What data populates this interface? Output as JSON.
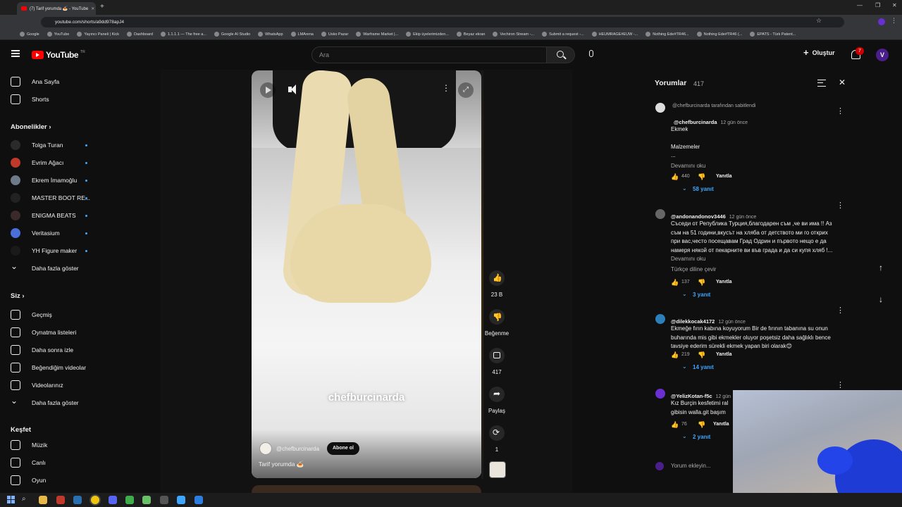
{
  "browser": {
    "tab_title": "(7) Tarif yorumda 🍝 - YouTube",
    "url": "youtube.com/shorts/a9dd978apJ4",
    "bookmarks": [
      "Google",
      "YouTube",
      "Yayıncı Paneli | Kick",
      "Dashboard",
      "1.1.1.1 — The free a...",
      "Google AI Studio",
      "WhatsApp",
      "LMArena",
      "Usko Pazar",
      "Warframe Market |...",
      "Ekip üyelerimizden...",
      "Beyaz ekran",
      "Vechiron Stream -...",
      "Submit a request -...",
      "HEUMRAGE#EUW -...",
      "Nothing Ede#TR46...",
      "Nothing Ede#TR46 (...",
      "EPATS - Türk Patent..."
    ]
  },
  "header": {
    "logo": "YouTube",
    "logo_region": "TR",
    "search_placeholder": "Ara",
    "create_label": "Oluştur",
    "notifications_count": "7",
    "avatar_letter": "V"
  },
  "sidebar": {
    "main": [
      {
        "label": "Ana Sayfa",
        "icon": "home-icon"
      },
      {
        "label": "Shorts",
        "icon": "shorts-icon"
      }
    ],
    "subs_title": "Abonelikler",
    "subs": [
      {
        "label": "Tolga Turan",
        "color": "#2b2b2b"
      },
      {
        "label": "Evrim Ağacı",
        "color": "#c0392b"
      },
      {
        "label": "Ekrem İmamoğlu",
        "color": "#6d7a8a"
      },
      {
        "label": "MASTER BOOT RE...",
        "color": "#222222"
      },
      {
        "label": "ENIGMA BEATS",
        "color": "#3a2a2a"
      },
      {
        "label": "Veritasium",
        "color": "#4a6fd8"
      },
      {
        "label": "YH Figure maker",
        "color": "#1a1a1a"
      }
    ],
    "subs_more": "Daha fazla göster",
    "you_title": "Siz",
    "you": [
      {
        "label": "Geçmiş",
        "icon": "history-icon"
      },
      {
        "label": "Oynatma listeleri",
        "icon": "playlist-icon"
      },
      {
        "label": "Daha sonra izle",
        "icon": "clock-icon"
      },
      {
        "label": "Beğendiğim videolar",
        "icon": "like-icon"
      },
      {
        "label": "Videolarınız",
        "icon": "video-icon"
      }
    ],
    "you_more": "Daha fazla göster",
    "explore_title": "Keşfet",
    "explore": [
      {
        "label": "Müzik",
        "icon": "music-icon"
      },
      {
        "label": "Canlı",
        "icon": "live-icon"
      },
      {
        "label": "Oyun",
        "icon": "gaming-icon"
      }
    ]
  },
  "short": {
    "watermark": "chefburcinarda",
    "channel": "@chefburcinarda",
    "subscribe_label": "Abone ol",
    "title": "Tarif yorumda 🍝",
    "likes": "23 B",
    "dislike_label": "Beğenme",
    "comments": "417",
    "share_label": "Paylaş",
    "remix_count": "1"
  },
  "comments": {
    "title": "Yorumlar",
    "count": "417",
    "pinned_note": "@chefburcinarda tarafından sabitlendi",
    "add_placeholder": "Yorum ekleyin...",
    "items": [
      {
        "author": "@chefburcinarda",
        "time": "12 gün önce",
        "lines": [
          "Ekmek",
          "",
          "Malzemeler",
          "..."
        ],
        "read_more": "Devamını oku",
        "likes": "440",
        "reply": "Yanıtla",
        "replies": "58 yanıt"
      },
      {
        "author": "@andonandonov3446",
        "time": "12 gün önce",
        "lines": [
          "Съседи от Република Турция,благодарен съм ,че ви има !! Аз",
          "съм на 51 години,вкусът на хляба от детството ми го открих",
          "при вас,често посещавам Град Одрин и първото нещо е да",
          "намеря някой от пекарните ви във града и да си купя хляб !..."
        ],
        "read_more": "Devamını oku",
        "translate": "Türkçe diline çevir",
        "likes": "137",
        "reply": "Yanıtla",
        "replies": "3 yanıt"
      },
      {
        "author": "@dilekkocak4172",
        "time": "12 gün önce",
        "lines": [
          "Ekmeğe fırın kabına koyuyorum Bir de fırının tabanına su onun",
          "buharında mis gibi ekmekler oluyor poşetsiz daha sağlıklı bence",
          "tavsiye ederim sürekli ekmek yapan biri olarak😊"
        ],
        "likes": "219",
        "reply": "Yanıtla",
        "replies": "14 yanıt"
      },
      {
        "author": "@YelizKotan-f5c",
        "time": "12 gün",
        "lines": [
          "Kız Burçin kesfetimi ral",
          "gibisin walla.git başım"
        ],
        "likes": "76",
        "reply": "Yanıtla",
        "replies": "2 yanıt"
      }
    ]
  }
}
